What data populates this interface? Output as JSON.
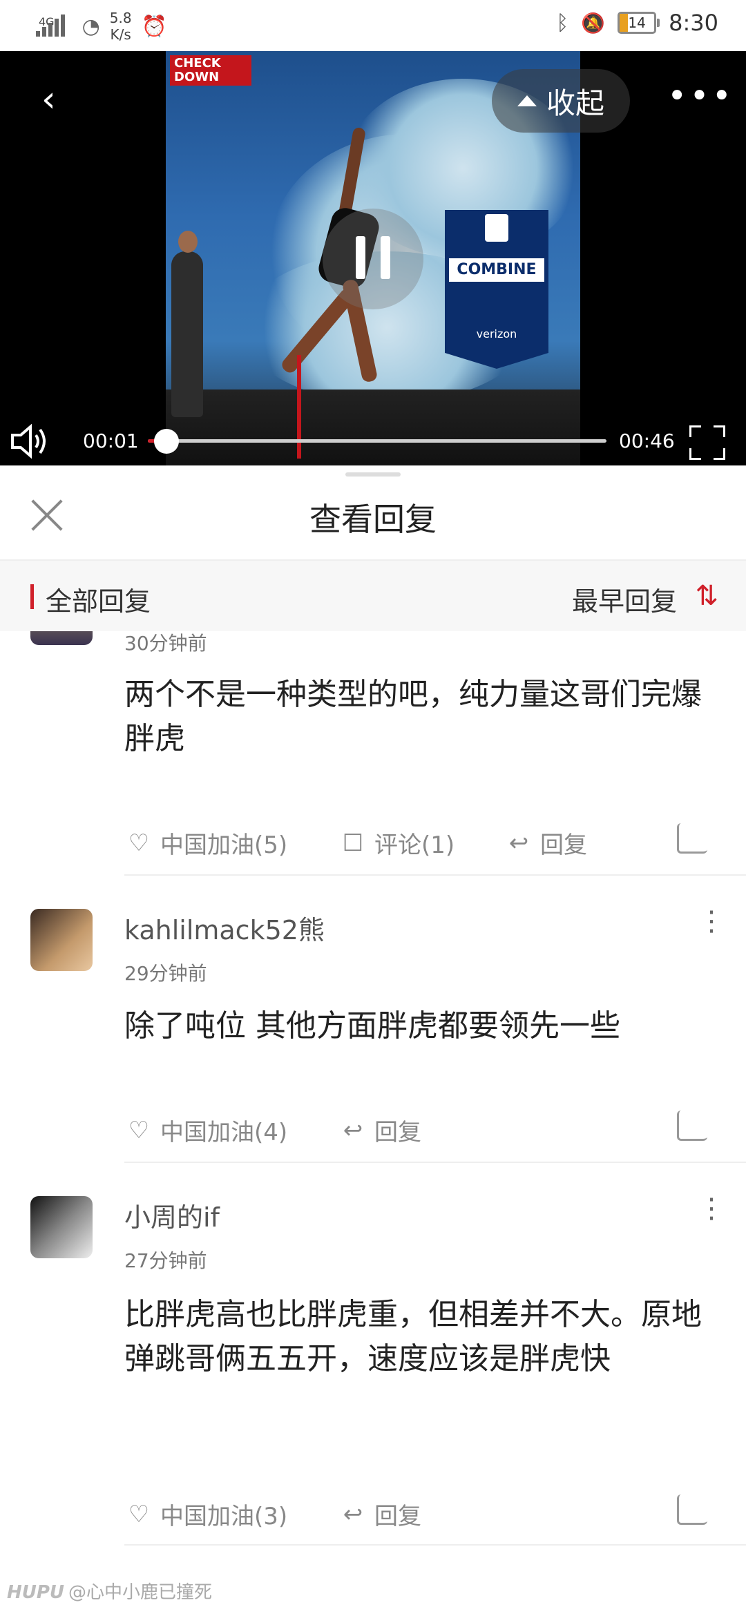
{
  "status_bar": {
    "network": "4G",
    "speed_value": "5.8",
    "speed_unit": "K/s",
    "battery": "14",
    "time": "8:30",
    "icons": [
      "signal-icon",
      "wifi-icon",
      "alarm-icon",
      "bluetooth-icon",
      "mute-bell-icon",
      "battery-icon"
    ]
  },
  "video": {
    "logo_text": "CHECK DOWN",
    "sign_combine": "COMBINE",
    "sign_sponsor": "verizon",
    "collapse_label": "收起",
    "current_time": "00:01",
    "duration": "00:46",
    "progress": 0.04,
    "accent_color": "#d0202a"
  },
  "sheet": {
    "title": "查看回复",
    "filter_all": "全部回复",
    "filter_sort": "最早回复"
  },
  "comments": [
    {
      "user": "",
      "time": "30分钟前",
      "text": "两个不是一种类型的吧，纯力量这哥们完爆胖虎",
      "likes": "中国加油(5)",
      "comments": "评论(1)",
      "reply": "回复"
    },
    {
      "user": "kahlilmack52熊",
      "time": "29分钟前",
      "text": "除了吨位 其他方面胖虎都要领先一些",
      "likes": "中国加油(4)",
      "reply": "回复"
    },
    {
      "user": "小周的if",
      "time": "27分钟前",
      "text": "比胖虎高也比胖虎重，但相差并不大。原地弹跳哥俩五五开，速度应该是胖虎快",
      "likes": "中国加油(3)",
      "reply": "回复"
    }
  ],
  "watermark": {
    "brand": "HUPU",
    "text": "@心中小鹿已撞死"
  }
}
